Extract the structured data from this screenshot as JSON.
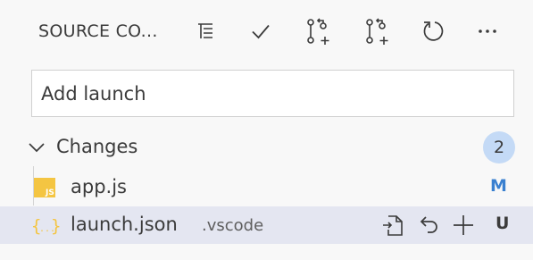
{
  "header": {
    "title": "SOURCE CO...",
    "actions": [
      {
        "icon": "view-as-tree-icon"
      },
      {
        "icon": "commit-check-icon"
      },
      {
        "icon": "create-pull-request-icon"
      },
      {
        "icon": "create-pull-request-icon"
      },
      {
        "icon": "refresh-icon"
      },
      {
        "icon": "more-actions-icon"
      }
    ]
  },
  "commit": {
    "value": "Add launch",
    "placeholder": ""
  },
  "changes": {
    "label": "Changes",
    "count": "2",
    "files": [
      {
        "name": "app.js",
        "icon": "javascript-file-icon",
        "description": "",
        "status": "M",
        "status_color": "#3a80d0"
      },
      {
        "name": "launch.json",
        "icon": "json-file-icon",
        "description": ".vscode",
        "status": "U",
        "status_color": "#3b3b3b"
      }
    ]
  },
  "colors": {
    "background": "#f8f8f8",
    "selected_row": "#e4e6f1",
    "badge": "#c4daf6",
    "js_icon": "#f4c542",
    "json_icon": "#f4c542"
  }
}
